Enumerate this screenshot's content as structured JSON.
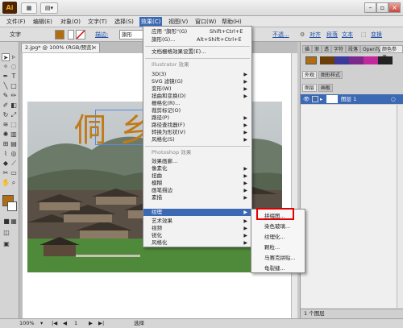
{
  "app": {
    "logo": "Ai"
  },
  "window_controls": {
    "minimize": "–",
    "restore": "▫",
    "close": "×"
  },
  "menubar": {
    "items": [
      "文件(F)",
      "编辑(E)",
      "对象(O)",
      "文字(T)",
      "选择(S)",
      "效果(C)",
      "视图(V)",
      "窗口(W)",
      "帮助(H)"
    ],
    "active_index": 5
  },
  "controlbar": {
    "tool_label": "文字",
    "stroke_label": "描边:",
    "brush_label": "旗形",
    "opacity_link": "不透...",
    "align_link": "对齐",
    "text_link": "段落",
    "char_link": "文本",
    "transform_link": "变换"
  },
  "document": {
    "tab_title": "2.jpg* @ 100% (RGB/预览)",
    "close_glyph": "×"
  },
  "canvas_text": "侗 乡",
  "effect_menu": {
    "apply_label": "应用 \"旗形\"(G)",
    "apply_shortcut": "Shift+Ctrl+E",
    "flag_label": "旗形(G)...",
    "flag_shortcut": "Alt+Shift+Ctrl+E",
    "doc_raster_label": "文档栅格效果设置(E)...",
    "illustrator_header": "Illustrator 效果",
    "illustrator_items": [
      "3D(3)",
      "SVG 滤镜(G)",
      "变形(W)",
      "扭曲和变换(D)",
      "栅格化(R)...",
      "裁剪标记(O)",
      "路径(P)",
      "路径查找器(F)",
      "转换为形状(V)",
      "风格化(S)"
    ],
    "photoshop_header": "Photoshop 效果",
    "photoshop_items": [
      "效果画廊...",
      "像素化",
      "扭曲",
      "模糊",
      "画笔描边",
      "素描",
      "纹理",
      "艺术效果",
      "视频",
      "锐化",
      "风格化"
    ],
    "highlighted": "纹理",
    "submenu_arrow": "▶"
  },
  "texture_submenu": {
    "items": [
      "拼缀图...",
      "染色玻璃...",
      "纹理化...",
      "颗粒...",
      "马赛克拼贴...",
      "龟裂缝..."
    ]
  },
  "right_panel": {
    "tabs_top": [
      "描",
      "渐",
      "透",
      "字符",
      "段落",
      "OpenTy",
      "颜色参考"
    ],
    "tabs_mid": [
      "外观",
      "图形样式"
    ],
    "tabs_layers": [
      "图层",
      "画板"
    ],
    "layer_name": "图层 1",
    "footer": "1 个图层"
  },
  "statusbar": {
    "zoom": "100%",
    "page": "1",
    "tool": "选择"
  }
}
